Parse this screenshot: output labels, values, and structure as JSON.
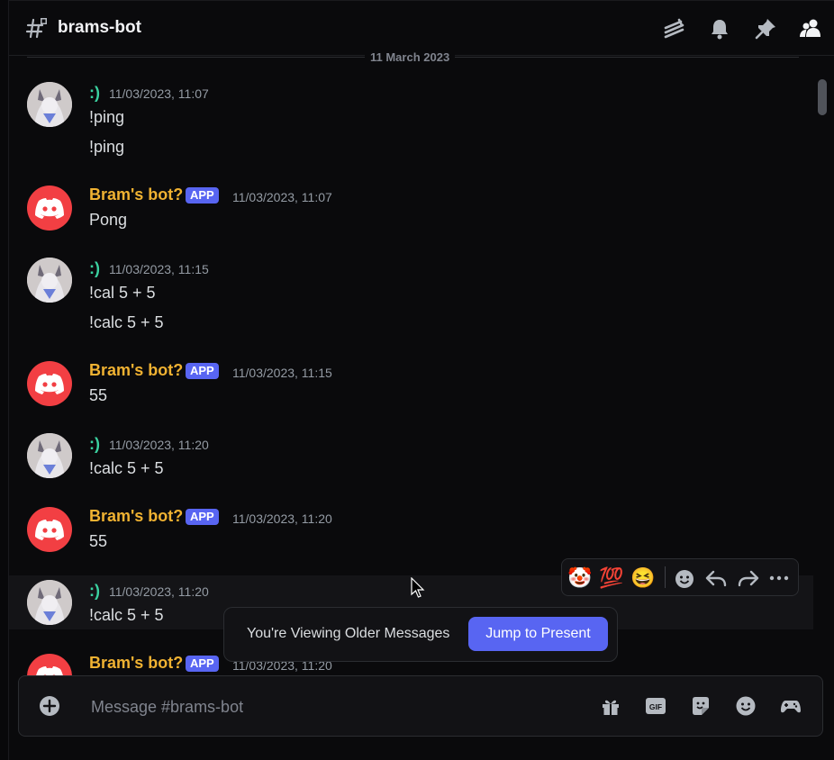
{
  "header": {
    "channel_name": "brams-bot",
    "icons": [
      "threads-icon",
      "bell-icon",
      "pin-icon",
      "members-icon"
    ]
  },
  "divider": {
    "date": "11 March 2023"
  },
  "messages": [
    {
      "author": ":)",
      "type": "user",
      "time": "11/03/2023, 11:07",
      "lines": [
        "!ping",
        "!ping"
      ]
    },
    {
      "author": "Bram's bot?",
      "type": "bot",
      "tag": "APP",
      "time": "11/03/2023, 11:07",
      "lines": [
        "Pong"
      ]
    },
    {
      "author": ":)",
      "type": "user",
      "time": "11/03/2023, 11:15",
      "lines": [
        "!cal 5 + 5",
        "!calc 5 + 5"
      ]
    },
    {
      "author": "Bram's bot?",
      "type": "bot",
      "tag": "APP",
      "time": "11/03/2023, 11:15",
      "lines": [
        "55"
      ]
    },
    {
      "author": ":)",
      "type": "user",
      "time": "11/03/2023, 11:20",
      "lines": [
        "!calc 5 + 5"
      ]
    },
    {
      "author": "Bram's bot?",
      "type": "bot",
      "tag": "APP",
      "time": "11/03/2023, 11:20",
      "lines": [
        "55"
      ]
    },
    {
      "author": ":)",
      "type": "user",
      "time": "11/03/2023, 11:20",
      "lines": [
        "!calc 5 + 5"
      ]
    },
    {
      "author": "Bram's bot?",
      "type": "bot",
      "tag": "APP",
      "time": "11/03/2023, 11:20",
      "lines": []
    }
  ],
  "toolbar": {
    "reactions": [
      "🤡",
      "💯",
      "😆"
    ],
    "actions": [
      "add-reaction-icon",
      "reply-icon",
      "forward-icon",
      "more-icon"
    ]
  },
  "jump_bar": {
    "text": "You're Viewing Older Messages",
    "button": "Jump to Present"
  },
  "composer": {
    "placeholder": "Message #brams-bot",
    "icons": [
      "gift-icon",
      "gif-icon",
      "sticker-icon",
      "emoji-icon",
      "game-icon"
    ]
  },
  "colors": {
    "accent": "#5865f2",
    "user_name": "#3bd1a0",
    "bot_name": "#f0b232",
    "bot_avatar": "#f23f43"
  }
}
